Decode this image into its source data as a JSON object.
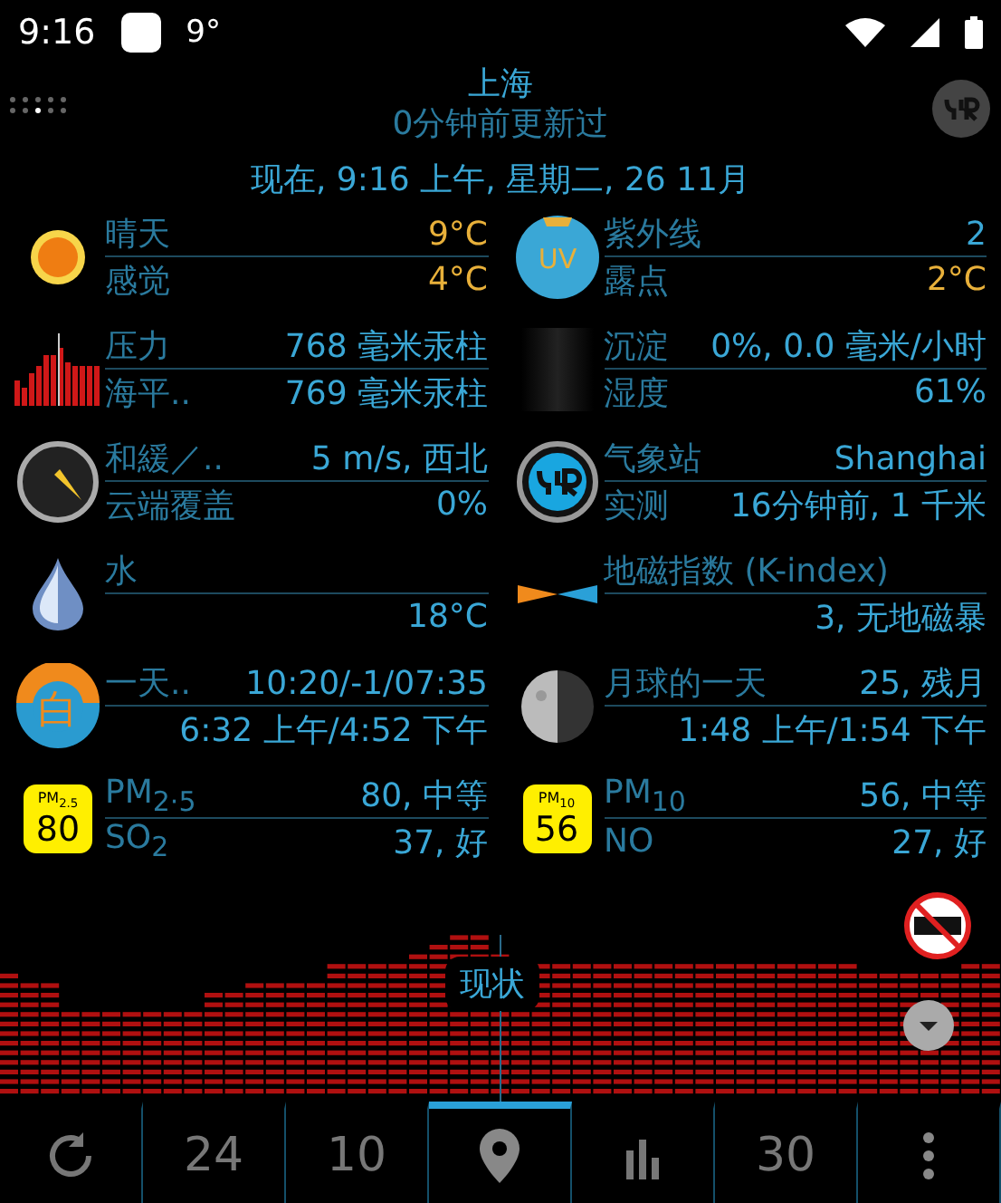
{
  "status_bar": {
    "time": "9:16",
    "temperature": "9°"
  },
  "header": {
    "city": "上海",
    "updated": "0分钟前更新过",
    "now": "现在, 9:16 上午, 星期二, 26 11月"
  },
  "rows": [
    [
      {
        "kind": "sun",
        "lines": [
          {
            "label": "晴天",
            "value": "9°C",
            "highlight": true
          },
          {
            "label": "感觉",
            "value": "4°C",
            "highlight": true
          }
        ]
      },
      {
        "kind": "uv",
        "icon_text": "UV",
        "lines": [
          {
            "label": "紫外线",
            "value": "2",
            "highlight": false
          },
          {
            "label": "露点",
            "value": "2°C",
            "highlight": true
          }
        ]
      }
    ],
    [
      {
        "kind": "pressure",
        "lines": [
          {
            "label": "压力",
            "value": "768 毫米汞柱",
            "highlight": false
          },
          {
            "label": "海平..",
            "value": "769 毫米汞柱",
            "highlight": false
          }
        ]
      },
      {
        "kind": "precipitation",
        "lines": [
          {
            "label": "沉淀",
            "value": "0%, 0.0 毫米/小时",
            "highlight": false
          },
          {
            "label": "湿度",
            "value": "61%",
            "highlight": false
          }
        ]
      }
    ],
    [
      {
        "kind": "compass",
        "lines": [
          {
            "label": "和緩／..",
            "value": "5 m/s, 西北",
            "highlight": false
          },
          {
            "label": "云端覆盖",
            "value": "0%",
            "highlight": false
          }
        ]
      },
      {
        "kind": "station",
        "lines": [
          {
            "label": "气象站",
            "value": "Shanghai",
            "highlight": false
          },
          {
            "label": "实测",
            "value": "16分钟前, 1 千米",
            "highlight": false
          }
        ]
      }
    ],
    [
      {
        "kind": "drop",
        "lines": [
          {
            "label": "水"
          },
          {
            "value": "18°C",
            "highlight": false
          }
        ]
      },
      {
        "kind": "kindex",
        "lines": [
          {
            "label": "地磁指数 (K-index)"
          },
          {
            "value": "3, 无地磁暴",
            "highlight": false
          }
        ]
      }
    ],
    [
      {
        "kind": "daylight",
        "icon_text": "白",
        "lines": [
          {
            "label": "一天..",
            "value": "10:20/-1/07:35",
            "highlight": false
          },
          {
            "value": "6:32 上午/4:52 下午",
            "highlight": false
          }
        ]
      },
      {
        "kind": "moon",
        "lines": [
          {
            "label": "月球的一天",
            "value": "25, 残月",
            "highlight": false
          },
          {
            "value": "1:48 上午/1:54 下午",
            "highlight": false
          }
        ]
      }
    ],
    [
      {
        "kind": "badge",
        "badge_label": "PM$_{2.5}$",
        "icon_text": "80",
        "lines": [
          {
            "label": "PM$_{2·5}$",
            "value": "80, 中等",
            "highlight": false
          },
          {
            "label": "SO$_{2}$",
            "value": "37, 好",
            "highlight": false
          }
        ]
      },
      {
        "kind": "badge",
        "badge_label": "PM$_{10}$",
        "icon_text": "56",
        "lines": [
          {
            "label": "PM$_{10}$",
            "value": "56, 中等",
            "highlight": false
          },
          {
            "label": "NO",
            "value": "27, 好",
            "highlight": false
          }
        ]
      }
    ]
  ],
  "chart_label": "现状",
  "nav": [
    {
      "kind": "refresh",
      "selected": false
    },
    {
      "kind": "text",
      "text": "24",
      "selected": false
    },
    {
      "kind": "text",
      "text": "10",
      "selected": false
    },
    {
      "kind": "location",
      "selected": true
    },
    {
      "kind": "bars",
      "selected": false
    },
    {
      "kind": "text",
      "text": "30",
      "selected": false
    },
    {
      "kind": "more",
      "selected": false
    }
  ]
}
